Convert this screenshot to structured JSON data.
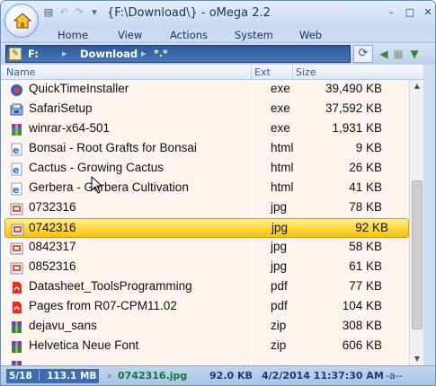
{
  "window": {
    "title": "{F:\\Download\\} - oMega 2.2",
    "minimize": "–",
    "maximize": "□",
    "close": "✕"
  },
  "quick_access": [
    "▤",
    "↶",
    "↷",
    "▾"
  ],
  "tabs": [
    "Home",
    "View",
    "Actions",
    "System",
    "Web"
  ],
  "path": {
    "drive": "F:",
    "separator": "▸",
    "folder": "Download",
    "filter": "*.*"
  },
  "columns": {
    "name": "Name",
    "ext": "Ext",
    "size": "Size"
  },
  "files": [
    {
      "name": "QuickTimeInstaller",
      "ext": "exe",
      "size": "39,490 KB",
      "icon": "quicktime-icon"
    },
    {
      "name": "SafariSetup",
      "ext": "exe",
      "size": "37,592 KB",
      "icon": "installer-icon"
    },
    {
      "name": "winrar-x64-501",
      "ext": "exe",
      "size": "1,931 KB",
      "icon": "winrar-icon"
    },
    {
      "name": "Bonsai - Root Grafts for Bonsai",
      "ext": "html",
      "size": "9 KB",
      "icon": "ie-html-icon"
    },
    {
      "name": "Cactus - Growing Cactus",
      "ext": "html",
      "size": "26 KB",
      "icon": "ie-html-icon"
    },
    {
      "name": "Gerbera - Gerbera Cultivation",
      "ext": "html",
      "size": "41 KB",
      "icon": "ie-html-icon"
    },
    {
      "name": "0732316",
      "ext": "jpg",
      "size": "78 KB",
      "icon": "image-icon"
    },
    {
      "name": "0742316",
      "ext": "jpg",
      "size": "92 KB",
      "icon": "image-icon",
      "selected": true
    },
    {
      "name": "0842317",
      "ext": "jpg",
      "size": "58 KB",
      "icon": "image-icon"
    },
    {
      "name": "0852316",
      "ext": "jpg",
      "size": "61 KB",
      "icon": "image-icon"
    },
    {
      "name": "Datasheet_ToolsProgramming",
      "ext": "pdf",
      "size": "77 KB",
      "icon": "pdf-icon"
    },
    {
      "name": "Pages from R07-CPM11.02",
      "ext": "pdf",
      "size": "104 KB",
      "icon": "pdf-icon"
    },
    {
      "name": "dejavu_sans",
      "ext": "zip",
      "size": "308 KB",
      "icon": "archive-icon"
    },
    {
      "name": "Helvetica Neue Font",
      "ext": "zip",
      "size": "606 KB",
      "icon": "archive-icon"
    },
    {
      "name": "",
      "ext": "",
      "size": "",
      "icon": "archive-icon"
    }
  ],
  "status": {
    "count": "5/18",
    "total": "113.1 MB",
    "file": "0742316.jpg",
    "file_size": "92.0 KB",
    "date": "4/2/2014 11:37:30 AM",
    "attributes": "-a--"
  },
  "colors": {
    "selection": "#ffd63a",
    "list_background": "#fdf4ef",
    "path_bar": "#2f5996",
    "status_file": "#0b7a3a"
  }
}
